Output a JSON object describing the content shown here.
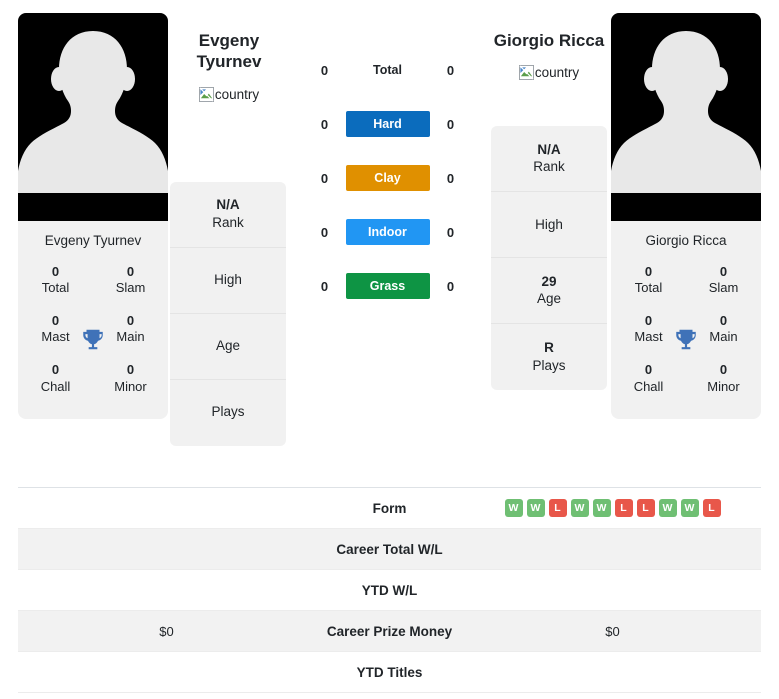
{
  "players": {
    "left": {
      "name": "Evgeny Tyurnev",
      "name_line1": "Evgeny",
      "name_line2": "Tyurnev",
      "country_alt": "country",
      "photo_caption": "Evgeny Tyurnev",
      "titles": [
        {
          "value": "0",
          "label": "Total"
        },
        {
          "value": "0",
          "label": "Slam"
        },
        {
          "value": "0",
          "label": "Mast"
        },
        {
          "value": "0",
          "label": "Main"
        },
        {
          "value": "0",
          "label": "Chall"
        },
        {
          "value": "0",
          "label": "Minor"
        }
      ],
      "info": [
        {
          "value": "N/A",
          "label": "Rank"
        },
        {
          "value": "",
          "label": "High"
        },
        {
          "value": "",
          "label": "Age"
        },
        {
          "value": "",
          "label": "Plays"
        }
      ]
    },
    "right": {
      "name": "Giorgio Ricca",
      "name_line1": "Giorgio Ricca",
      "name_line2": "",
      "country_alt": "country",
      "photo_caption": "Giorgio Ricca",
      "titles": [
        {
          "value": "0",
          "label": "Total"
        },
        {
          "value": "0",
          "label": "Slam"
        },
        {
          "value": "0",
          "label": "Mast"
        },
        {
          "value": "0",
          "label": "Main"
        },
        {
          "value": "0",
          "label": "Chall"
        },
        {
          "value": "0",
          "label": "Minor"
        }
      ],
      "info": [
        {
          "value": "N/A",
          "label": "Rank"
        },
        {
          "value": "",
          "label": "High"
        },
        {
          "value": "29",
          "label": "Age"
        },
        {
          "value": "R",
          "label": "Plays"
        }
      ]
    }
  },
  "surfaces": [
    {
      "label": "Total",
      "left": "0",
      "right": "0",
      "color": "transparent",
      "plain": true
    },
    {
      "label": "Hard",
      "left": "0",
      "right": "0",
      "color": "#0b6cbd",
      "plain": false
    },
    {
      "label": "Clay",
      "left": "0",
      "right": "0",
      "color": "#e09000",
      "plain": false
    },
    {
      "label": "Indoor",
      "left": "0",
      "right": "0",
      "color": "#2196f3",
      "plain": false
    },
    {
      "label": "Grass",
      "left": "0",
      "right": "0",
      "color": "#0e9444",
      "plain": false
    }
  ],
  "table": {
    "rows": [
      {
        "label": "Form",
        "left": "",
        "right": "",
        "left_form": [],
        "right_form": [
          "W",
          "W",
          "L",
          "W",
          "W",
          "L",
          "L",
          "W",
          "W",
          "L"
        ]
      },
      {
        "label": "Career Total W/L",
        "left": "",
        "right": ""
      },
      {
        "label": "YTD W/L",
        "left": "",
        "right": ""
      },
      {
        "label": "Career Prize Money",
        "left": "$0",
        "right": "$0"
      },
      {
        "label": "YTD Titles",
        "left": "",
        "right": ""
      }
    ]
  },
  "colors": {
    "win": "#6fbf73",
    "loss": "#e8574a",
    "card_bg": "#f1f1f1",
    "stripe": "#f2f2f2"
  }
}
